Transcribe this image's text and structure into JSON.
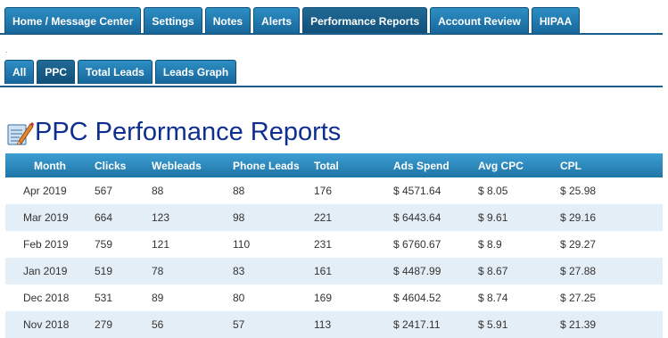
{
  "top_tabs": [
    {
      "label": "Home / Message Center"
    },
    {
      "label": "Settings"
    },
    {
      "label": "Notes"
    },
    {
      "label": "Alerts"
    },
    {
      "label": "Performance Reports",
      "active": true
    },
    {
      "label": "Account Review"
    },
    {
      "label": "HIPAA"
    }
  ],
  "divider_dot": ".",
  "sub_tabs": [
    {
      "label": "All"
    },
    {
      "label": "PPC",
      "active": true
    },
    {
      "label": "Total Leads"
    },
    {
      "label": "Leads Graph"
    }
  ],
  "page_title": "PPC Performance Reports",
  "table": {
    "columns": [
      "Month",
      "Clicks",
      "Webleads",
      "Phone Leads",
      "Total",
      "Ads Spend",
      "Avg CPC",
      "CPL"
    ],
    "rows": [
      [
        "Apr 2019",
        "567",
        "88",
        "88",
        "176",
        "$ 4571.64",
        "$ 8.05",
        "$ 25.98"
      ],
      [
        "Mar 2019",
        "664",
        "123",
        "98",
        "221",
        "$ 6443.64",
        "$ 9.61",
        "$ 29.16"
      ],
      [
        "Feb 2019",
        "759",
        "121",
        "110",
        "231",
        "$ 6760.67",
        "$ 8.9",
        "$ 29.27"
      ],
      [
        "Jan 2019",
        "519",
        "78",
        "83",
        "161",
        "$ 4487.99",
        "$ 8.67",
        "$ 27.88"
      ],
      [
        "Dec 2018",
        "531",
        "89",
        "80",
        "169",
        "$ 4604.52",
        "$ 8.74",
        "$ 27.25"
      ],
      [
        "Nov 2018",
        "279",
        "56",
        "57",
        "113",
        "$ 2417.11",
        "$ 5.91",
        "$ 21.39"
      ]
    ]
  },
  "colors": {
    "tab": "#1f75a8",
    "tab_active": "#16577f",
    "title": "#0e2f8f",
    "row_alt": "#e4eef6"
  }
}
